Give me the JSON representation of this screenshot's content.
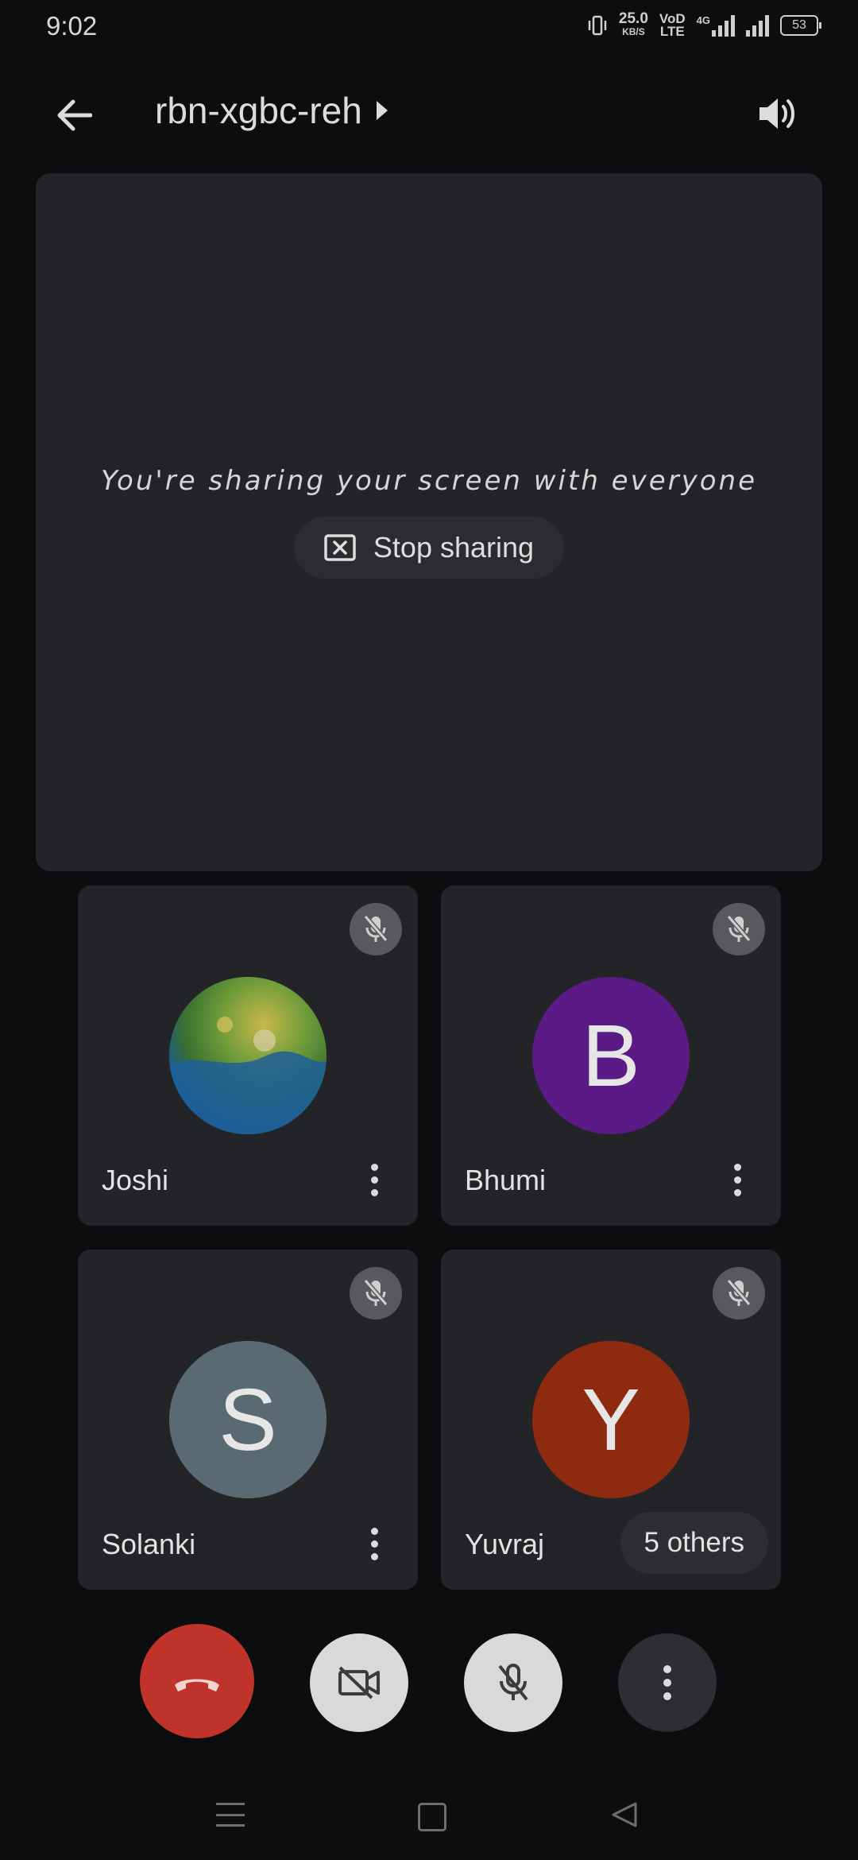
{
  "status_bar": {
    "time": "9:02",
    "net_speed": "25.0",
    "net_unit": "KB/S",
    "volte_top": "VoD",
    "volte_bottom": "LTE",
    "net_type": "4G",
    "battery": "53"
  },
  "header": {
    "meeting_code": "rbn-xgbc-reh"
  },
  "share": {
    "message": "You're sharing your screen with everyone",
    "stop_label": "Stop sharing"
  },
  "participants": [
    {
      "name": "Joshi",
      "initial": "",
      "avatar_color": "#3b7a3a"
    },
    {
      "name": "Bhumi",
      "initial": "B",
      "avatar_color": "#5b1a85"
    },
    {
      "name": "Solanki",
      "initial": "S",
      "avatar_color": "#5a6a72"
    },
    {
      "name": "Yuvraj",
      "initial": "Y",
      "avatar_color": "#8d2a10"
    }
  ],
  "others_label": "5 others",
  "colors": {
    "end_call": "#c0332b",
    "tile_bg": "#232427",
    "background": "#0c0d0f"
  },
  "icons": [
    "arrow-back-icon",
    "caret-right-icon",
    "speaker-icon",
    "stop-share-icon",
    "mic-off-icon",
    "more-vert-icon",
    "call-end-icon",
    "videocam-off-icon",
    "menu-icon",
    "home-icon",
    "back-triangle-icon"
  ]
}
